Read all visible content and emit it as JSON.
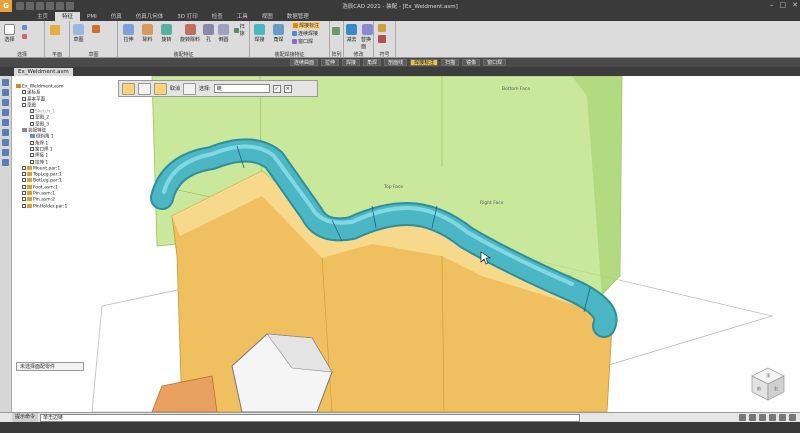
{
  "window": {
    "title": "浩辰CAD 2021 - 装配 - [Ex_Weldment.asm]",
    "logo": "G"
  },
  "ribbon_tabs": [
    "主页",
    "特征",
    "PMI",
    "仿真",
    "仿真几何体",
    "3D 打印",
    "检查",
    "工具",
    "视图",
    "数据管理"
  ],
  "active_tab_index": 1,
  "ribbon": {
    "groups": [
      {
        "label": "选择",
        "tools": [
          "选择"
        ]
      },
      {
        "label": "平面",
        "tools": [
          "草图"
        ]
      },
      {
        "label": "草图",
        "tools": [
          "草图"
        ]
      },
      {
        "label": "装配特征",
        "tools": [
          "拉伸",
          "除料",
          "旋转",
          "旋转除料",
          "孔",
          "倒圆",
          "扫掠"
        ]
      },
      {
        "label": "装配焊接特征",
        "tools": [
          "焊接",
          "角焊",
          "焊接标注",
          "连续焊接",
          "窗口焊"
        ]
      },
      {
        "label": "阵列",
        "tools": [
          "阵列"
        ]
      },
      {
        "label": "修改",
        "tools": [
          "减去",
          "替换面"
        ]
      },
      {
        "label": "符号",
        "tools": [
          "符号"
        ]
      }
    ]
  },
  "feature_bar": {
    "items": [
      "连续曲面",
      "拉伸",
      "焊接",
      "角焊",
      "剖面线",
      "焊接标注",
      "扫描",
      "镜像",
      "窗口焊"
    ],
    "highlight_index": 5
  },
  "document_tab": "Ex_Weldment.asm",
  "tree": {
    "items": [
      "Ex_Weldment.asm",
      "坐标系",
      "基本平面",
      "草图",
      "Sketch_1",
      "草图_2",
      "草图_3",
      "装配特征",
      "倒斜角 1",
      "角焊 1",
      "窗口焊 1",
      "焊接 1",
      "拉伸 1",
      "Mount.par:1",
      "TopLeg.par:1",
      "BotLeg.par:1",
      "Foot.asm:1",
      "Pin.asm:1",
      "Pin.asm:2",
      "PinHolder.par:1"
    ]
  },
  "command_bar": {
    "cancel_label": "取消",
    "select_label": "选择:",
    "select_value": "链"
  },
  "prompt_box": "未选择面配零件",
  "statusbar": {
    "label": "提示命令",
    "field_value": "单击边链"
  },
  "viewcube_labels": [
    "顶",
    "前",
    "右"
  ],
  "model_labels": [
    "Bottom Face",
    "Top Face",
    "Right Face"
  ],
  "colors": {
    "weld_bead": "#4bb7c4",
    "body_orange": "#f0c060",
    "glass_green": "#b8e07a",
    "accent_tab": "#dcdcdc",
    "highlight": "#e8c24a"
  }
}
